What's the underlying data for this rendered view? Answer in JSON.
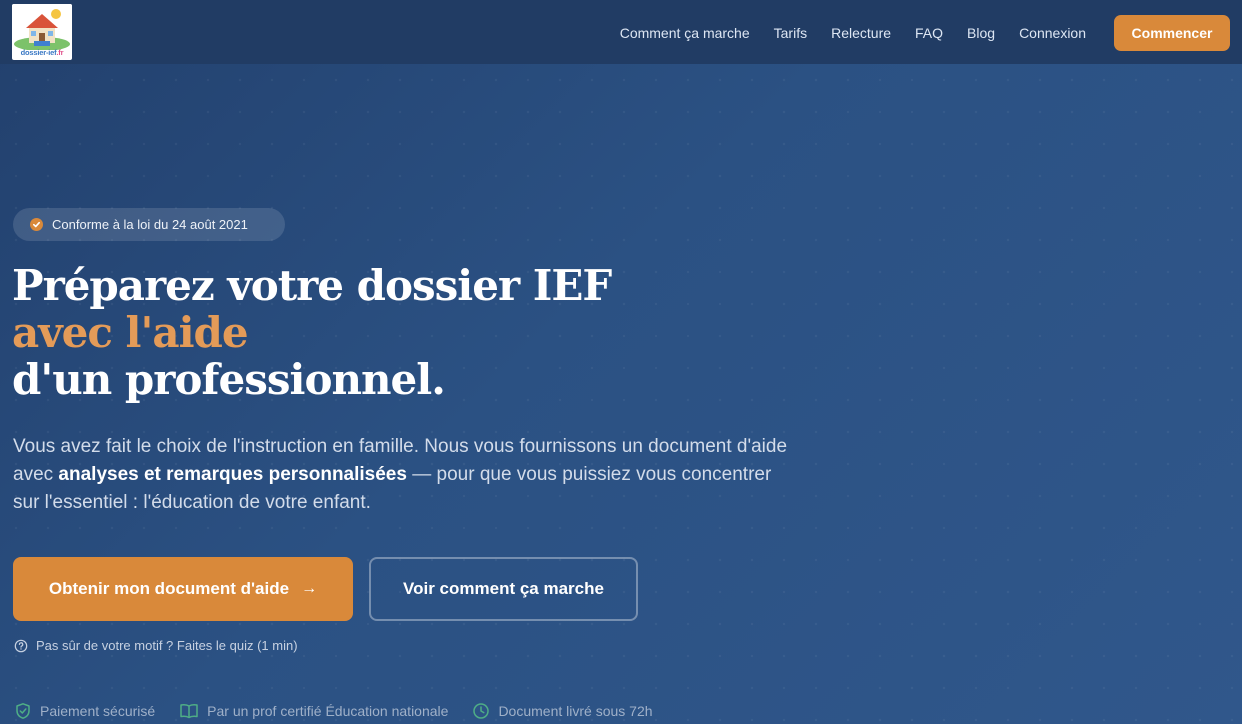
{
  "logo": {
    "text": "dossier-ief",
    "tld": ".fr"
  },
  "nav": {
    "items": [
      {
        "label": "Comment ça marche"
      },
      {
        "label": "Tarifs"
      },
      {
        "label": "Relecture"
      },
      {
        "label": "FAQ"
      },
      {
        "label": "Blog"
      },
      {
        "label": "Connexion"
      }
    ],
    "cta": "Commencer"
  },
  "hero": {
    "badge": "Conforme à la loi du 24 août 2021",
    "title_line1": "Préparez votre dossier IEF",
    "title_line2": "avec l'aide",
    "title_line3": "d'un professionnel.",
    "lead_before": "Vous avez fait le choix de l'instruction en famille. Nous vous fournissons un document d'aide avec ",
    "lead_bold": "analyses et remarques personnalisées",
    "lead_after": " — pour que vous puissiez vous concentrer sur l'essentiel : l'éducation de votre enfant.",
    "primary_button": "Obtenir mon document d'aide",
    "primary_arrow": "→",
    "secondary_button": "Voir comment ça marche",
    "quiz_link": "Pas sûr de votre motif ? Faites le quiz (1 min)"
  },
  "trust": [
    {
      "label": "Paiement sécurisé",
      "icon": "shield-icon"
    },
    {
      "label": "Par un prof certifié Éducation nationale",
      "icon": "book-icon"
    },
    {
      "label": "Document livré sous 72h",
      "icon": "clock-icon"
    }
  ],
  "colors": {
    "accent": "#d9893a",
    "accent_text": "#e49b58",
    "header_bg": "#213c64",
    "trust_icon": "#4fae86"
  }
}
